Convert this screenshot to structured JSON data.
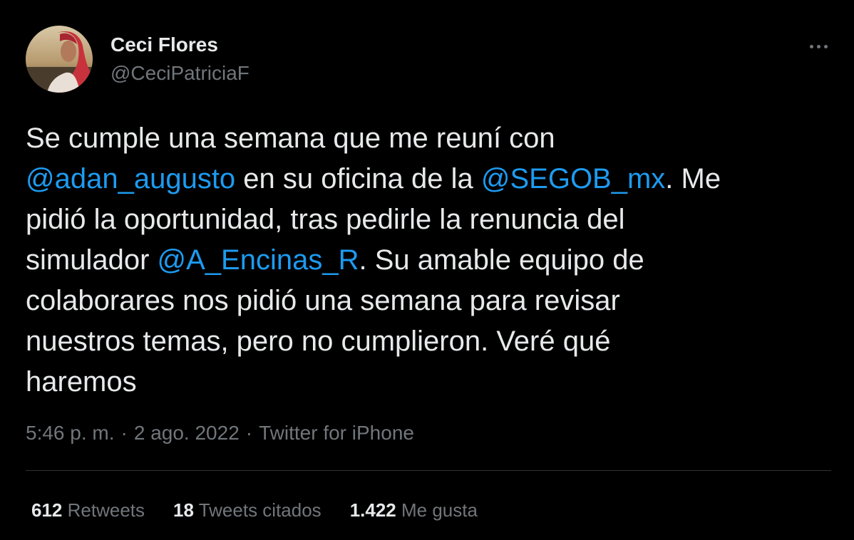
{
  "author": {
    "name": "Ceci Flores",
    "handle": "@CeciPatriciaF"
  },
  "tweet": {
    "lines": [
      [
        {
          "t": "Se cumple una semana que me reuní con"
        }
      ],
      [
        {
          "t": "@adan_augusto",
          "m": true
        },
        {
          "t": " en su oficina de la "
        },
        {
          "t": "@SEGOB_mx",
          "m": true
        },
        {
          "t": ". Me"
        }
      ],
      [
        {
          "t": "pidió la oportunidad, tras pedirle la renuncia del"
        }
      ],
      [
        {
          "t": "simulador "
        },
        {
          "t": "@A_Encinas_R",
          "m": true
        },
        {
          "t": ". Su amable equipo de"
        }
      ],
      [
        {
          "t": "colaborares nos pidió una semana para revisar"
        }
      ],
      [
        {
          "t": "nuestros temas, pero no cumplieron. Veré qué"
        }
      ],
      [
        {
          "t": "haremos"
        }
      ]
    ]
  },
  "meta": {
    "time": "5:46 p. m.",
    "separator": "·",
    "date": "2 ago. 2022",
    "source": "Twitter for iPhone"
  },
  "stats": [
    {
      "count": "612",
      "label": "Retweets"
    },
    {
      "count": "18",
      "label": "Tweets citados"
    },
    {
      "count": "1.422",
      "label": "Me gusta"
    }
  ],
  "icons": {
    "more": "more-horizontal-icon"
  },
  "colors": {
    "background": "#000000",
    "text": "#e7e9ea",
    "secondary": "#71767b",
    "link": "#1d9bf0",
    "divider": "#2f3336"
  }
}
